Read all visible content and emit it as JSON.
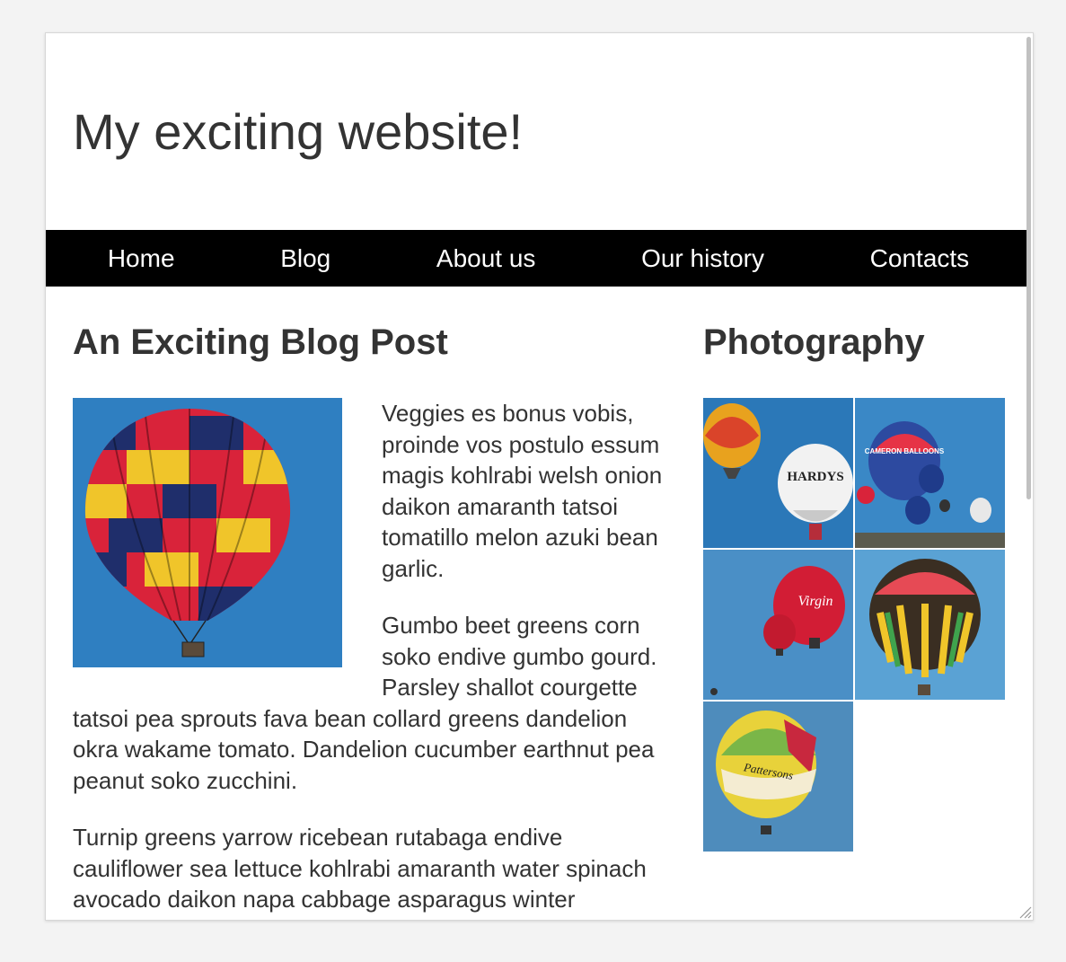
{
  "site": {
    "title": "My exciting website!"
  },
  "nav": {
    "items": [
      {
        "label": "Home"
      },
      {
        "label": "Blog"
      },
      {
        "label": "About us"
      },
      {
        "label": "Our history"
      },
      {
        "label": "Contacts"
      }
    ]
  },
  "post": {
    "title": "An Exciting Blog Post",
    "image_icon": "hot-air-balloon-photo",
    "paragraphs": [
      "Veggies es bonus vobis, proinde vos postulo essum magis kohlrabi welsh onion daikon amaranth tatsoi tomatillo melon azuki bean garlic.",
      "Gumbo beet greens corn soko endive gumbo gourd. Parsley shallot courgette tatsoi pea sprouts fava bean collard greens dandelion okra wakame tomato. Dandelion cucumber earthnut pea peanut soko zucchini.",
      "Turnip greens yarrow ricebean rutabaga endive cauliflower sea lettuce kohlrabi amaranth water spinach avocado daikon napa cabbage asparagus winter purslane kale."
    ]
  },
  "sidebar": {
    "title": "Photography",
    "photos": [
      {
        "name": "balloon-photo-hardys",
        "text": "HARDYS"
      },
      {
        "name": "balloon-photo-cameron",
        "text": "CAMERON BALLOONS"
      },
      {
        "name": "balloon-photo-virgin",
        "text": "Virgin"
      },
      {
        "name": "balloon-photo-rainbow",
        "text": ""
      },
      {
        "name": "balloon-photo-pattersons",
        "text": "Pattersons"
      }
    ]
  },
  "colors": {
    "nav_background": "#000000",
    "nav_text": "#ffffff",
    "text": "#333333",
    "sky": "#2f7fc1"
  }
}
